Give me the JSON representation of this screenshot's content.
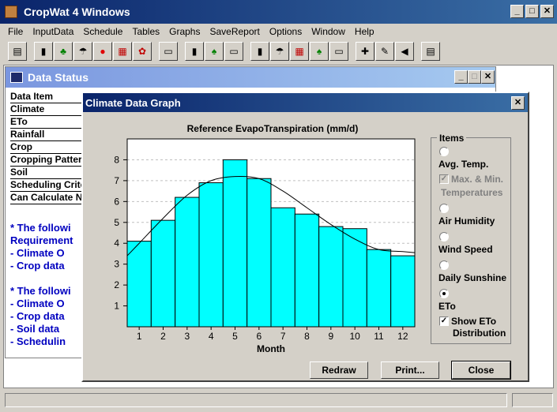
{
  "app": {
    "title": "CropWat 4 Windows"
  },
  "window_controls": {
    "minimize": "_",
    "maximize": "□",
    "close": "✕"
  },
  "menu": [
    "File",
    "InputData",
    "Schedule",
    "Tables",
    "Graphs",
    "SaveReport",
    "Options",
    "Window",
    "Help"
  ],
  "toolbar": {
    "buttons": [
      {
        "icon": "report-icon",
        "glyph": "▤"
      },
      {
        "icon": "thermometer-icon",
        "glyph": "▮"
      },
      {
        "icon": "plant-icon",
        "glyph": "♣"
      },
      {
        "icon": "rain-icon",
        "glyph": "☂"
      },
      {
        "icon": "apple-icon",
        "glyph": "●"
      },
      {
        "icon": "crop-pattern-icon",
        "glyph": "▦"
      },
      {
        "icon": "flower-icon",
        "glyph": "✿"
      },
      {
        "icon": "scale-icon",
        "glyph": "▭"
      },
      {
        "icon": "thermo-graph-icon",
        "glyph": "▮"
      },
      {
        "icon": "plant-graph-icon",
        "glyph": "♠"
      },
      {
        "icon": "scale-graph-icon",
        "glyph": "▭"
      },
      {
        "icon": "thermo-table-icon",
        "glyph": "▮"
      },
      {
        "icon": "rain-table-icon",
        "glyph": "☂"
      },
      {
        "icon": "pattern-table-icon",
        "glyph": "▦"
      },
      {
        "icon": "plant-table-icon",
        "glyph": "♠"
      },
      {
        "icon": "scale-table-icon",
        "glyph": "▭"
      },
      {
        "icon": "tools-icon",
        "glyph": "✚"
      },
      {
        "icon": "translate-icon",
        "glyph": "✎"
      },
      {
        "icon": "sound-icon",
        "glyph": "◀"
      },
      {
        "icon": "notepad-icon",
        "glyph": "▤"
      }
    ]
  },
  "data_status": {
    "title": "Data Status",
    "items": [
      "Data Item",
      "Climate",
      "ETo",
      "Rainfall",
      "Crop",
      "Cropping Patter",
      "Soil",
      "Scheduling Crite",
      "Can Calculate N"
    ],
    "notes": [
      "*  The followi",
      "Requirement",
      "  - Climate O",
      "  - Crop data",
      "",
      "*  The followi",
      "  - Climate O",
      "  - Crop data",
      "  - Soil data",
      "  - Schedulin"
    ]
  },
  "dialog": {
    "title": "Climate Data Graph",
    "items_label": "Items",
    "options": [
      {
        "label": "Avg. Temp.",
        "checked": false,
        "disabled": false
      },
      {
        "label": "Max. & Min.",
        "label2": "Temperatures",
        "checked": true,
        "disabled": true
      },
      {
        "label": "Air Humidity",
        "checked": false,
        "disabled": false
      },
      {
        "label": "Wind Speed",
        "checked": false,
        "disabled": false
      },
      {
        "label": "Daily Sunshine",
        "checked": false,
        "disabled": false
      },
      {
        "label": "ETo",
        "checked": true,
        "disabled": false
      }
    ],
    "distribution": {
      "label": "Show ETo",
      "label2": "Distribution",
      "checked": true
    },
    "buttons": {
      "redraw": "Redraw",
      "print": "Print...",
      "close": "Close"
    }
  },
  "chart_data": {
    "type": "bar",
    "title": "Reference EvapoTranspiration (mm/d)",
    "xlabel": "Month",
    "ylabel": "",
    "categories": [
      "1",
      "2",
      "3",
      "4",
      "5",
      "6",
      "7",
      "8",
      "9",
      "10",
      "11",
      "12"
    ],
    "values": [
      4.1,
      5.1,
      6.2,
      6.9,
      8.0,
      7.1,
      5.7,
      5.4,
      4.8,
      4.7,
      3.7,
      3.4
    ],
    "distribution_curve": [
      4.0,
      5.2,
      6.3,
      7.0,
      7.2,
      7.1,
      6.5,
      5.7,
      4.9,
      4.2,
      3.7,
      3.6
    ],
    "ylim": [
      0,
      9
    ],
    "yticks": [
      1,
      2,
      3,
      4,
      5,
      6,
      7,
      8
    ],
    "grid": true,
    "colors": {
      "bar": "#00ffff",
      "curve": "#000000",
      "grid": "#c0c0c0"
    }
  },
  "status_bar": {
    "left": "",
    "right": ""
  }
}
